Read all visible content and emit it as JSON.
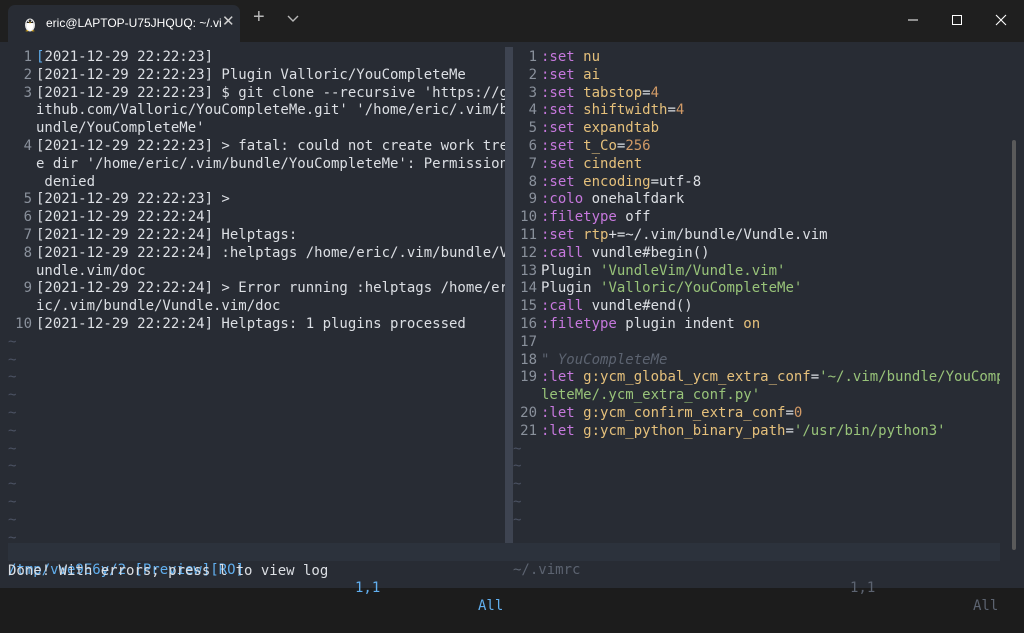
{
  "window": {
    "tab_title": "eric@LAPTOP-U75JHQUQ: ~/.vi",
    "tab_close": "✕",
    "new_tab": "+",
    "icons": {
      "tab": "linux-penguin-icon",
      "dropdown": "chevron-down-icon",
      "minimize": "minimize-icon",
      "maximize": "maximize-icon",
      "close": "close-icon"
    }
  },
  "left_pane": {
    "lines": [
      {
        "n": "1",
        "parts": [
          [
            "cursor",
            "["
          ],
          [
            "txt",
            "2021-12-29 22:22:23]"
          ]
        ]
      },
      {
        "n": "2",
        "parts": [
          [
            "txt",
            "[2021-12-29 22:22:23] Plugin Valloric/YouCompleteMe"
          ]
        ]
      },
      {
        "n": "3",
        "parts": [
          [
            "txt",
            "[2021-12-29 22:22:23] $ git clone --recursive 'https://g"
          ]
        ]
      },
      {
        "n": "",
        "parts": [
          [
            "txt",
            "ithub.com/Valloric/YouCompleteMe.git' '/home/eric/.vim/b"
          ]
        ]
      },
      {
        "n": "",
        "parts": [
          [
            "txt",
            "undle/YouCompleteMe'"
          ]
        ]
      },
      {
        "n": "4",
        "parts": [
          [
            "txt",
            "[2021-12-29 22:22:23] > fatal: could not create work tre"
          ]
        ]
      },
      {
        "n": "",
        "parts": [
          [
            "txt",
            "e dir '/home/eric/.vim/bundle/YouCompleteMe': Permission"
          ]
        ]
      },
      {
        "n": "",
        "parts": [
          [
            "txt",
            " denied"
          ]
        ]
      },
      {
        "n": "5",
        "parts": [
          [
            "txt",
            "[2021-12-29 22:22:23] >"
          ]
        ]
      },
      {
        "n": "6",
        "parts": [
          [
            "txt",
            "[2021-12-29 22:22:24]"
          ]
        ]
      },
      {
        "n": "7",
        "parts": [
          [
            "txt",
            "[2021-12-29 22:22:24] Helptags:"
          ]
        ]
      },
      {
        "n": "8",
        "parts": [
          [
            "txt",
            "[2021-12-29 22:22:24] :helptags /home/eric/.vim/bundle/V"
          ]
        ]
      },
      {
        "n": "",
        "parts": [
          [
            "txt",
            "undle.vim/doc"
          ]
        ]
      },
      {
        "n": "9",
        "parts": [
          [
            "txt",
            "[2021-12-29 22:22:24] > Error running :helptags /home/er"
          ]
        ]
      },
      {
        "n": "",
        "parts": [
          [
            "txt",
            "ic/.vim/bundle/Vundle.vim/doc"
          ]
        ]
      },
      {
        "n": "10",
        "parts": [
          [
            "txt",
            "[2021-12-29 22:22:24] Helptags: 1 plugins processed"
          ]
        ]
      }
    ],
    "tilde_count": 12,
    "tilde": "~"
  },
  "right_pane": {
    "lines": [
      {
        "n": "1",
        "parts": [
          [
            "kw",
            ":set"
          ],
          [
            "txt",
            " "
          ],
          [
            "opt",
            "nu"
          ]
        ]
      },
      {
        "n": "2",
        "parts": [
          [
            "kw",
            ":set"
          ],
          [
            "txt",
            " "
          ],
          [
            "opt",
            "ai"
          ]
        ]
      },
      {
        "n": "3",
        "parts": [
          [
            "kw",
            ":set"
          ],
          [
            "txt",
            " "
          ],
          [
            "opt",
            "tabstop"
          ],
          [
            "txt",
            "="
          ],
          [
            "num",
            "4"
          ]
        ]
      },
      {
        "n": "4",
        "parts": [
          [
            "kw",
            ":set"
          ],
          [
            "txt",
            " "
          ],
          [
            "opt",
            "shiftwidth"
          ],
          [
            "txt",
            "="
          ],
          [
            "num",
            "4"
          ]
        ]
      },
      {
        "n": "5",
        "parts": [
          [
            "kw",
            ":set"
          ],
          [
            "txt",
            " "
          ],
          [
            "opt",
            "expandtab"
          ]
        ]
      },
      {
        "n": "6",
        "parts": [
          [
            "kw",
            ":set"
          ],
          [
            "txt",
            " "
          ],
          [
            "opt",
            "t_Co"
          ],
          [
            "txt",
            "="
          ],
          [
            "num",
            "256"
          ]
        ]
      },
      {
        "n": "7",
        "parts": [
          [
            "kw",
            ":set"
          ],
          [
            "txt",
            " "
          ],
          [
            "opt",
            "cindent"
          ]
        ]
      },
      {
        "n": "8",
        "parts": [
          [
            "kw",
            ":set"
          ],
          [
            "txt",
            " "
          ],
          [
            "opt",
            "encoding"
          ],
          [
            "txt",
            "=utf-8"
          ]
        ]
      },
      {
        "n": "9",
        "parts": [
          [
            "kw",
            ":colo"
          ],
          [
            "txt",
            " onehalfdark"
          ]
        ]
      },
      {
        "n": "10",
        "parts": [
          [
            "kw",
            ":filetype"
          ],
          [
            "txt",
            " off"
          ]
        ]
      },
      {
        "n": "11",
        "parts": [
          [
            "kw",
            ":set"
          ],
          [
            "txt",
            " "
          ],
          [
            "opt",
            "rtp"
          ],
          [
            "txt",
            "+=~/.vim/bundle/Vundle.vim"
          ]
        ]
      },
      {
        "n": "12",
        "parts": [
          [
            "kw",
            ":call"
          ],
          [
            "txt",
            " vundle#begin()"
          ]
        ]
      },
      {
        "n": "13",
        "parts": [
          [
            "txt",
            "Plugin "
          ],
          [
            "str",
            "'VundleVim/Vundle.vim'"
          ]
        ]
      },
      {
        "n": "14",
        "parts": [
          [
            "txt",
            "Plugin "
          ],
          [
            "str",
            "'Valloric/YouCompleteMe'"
          ]
        ]
      },
      {
        "n": "15",
        "parts": [
          [
            "kw",
            ":call"
          ],
          [
            "txt",
            " vundle#end()"
          ]
        ]
      },
      {
        "n": "16",
        "parts": [
          [
            "kw",
            ":filetype"
          ],
          [
            "txt",
            " plugin indent "
          ],
          [
            "opt",
            "on"
          ]
        ]
      },
      {
        "n": "17",
        "parts": []
      },
      {
        "n": "18",
        "parts": [
          [
            "cmt",
            "\" YouCompleteMe"
          ]
        ]
      },
      {
        "n": "19",
        "parts": [
          [
            "kw",
            ":let"
          ],
          [
            "txt",
            " "
          ],
          [
            "opt",
            "g:ycm_global_ycm_extra_conf"
          ],
          [
            "txt",
            "="
          ],
          [
            "str",
            "'~/.vim/bundle/YouComp"
          ]
        ]
      },
      {
        "n": "",
        "parts": [
          [
            "str",
            "leteMe/.ycm_extra_conf.py'"
          ]
        ]
      },
      {
        "n": "20",
        "parts": [
          [
            "kw",
            ":let"
          ],
          [
            "txt",
            " "
          ],
          [
            "opt",
            "g:ycm_confirm_extra_conf"
          ],
          [
            "txt",
            "="
          ],
          [
            "num",
            "0"
          ]
        ]
      },
      {
        "n": "21",
        "parts": [
          [
            "kw",
            ":let"
          ],
          [
            "txt",
            " "
          ],
          [
            "opt",
            "g:ycm_python_binary_path"
          ],
          [
            "txt",
            "="
          ],
          [
            "str",
            "'/usr/bin/python3'"
          ]
        ]
      }
    ],
    "tilde_count": 5,
    "tilde": "~"
  },
  "status": {
    "left_file": "/tmp/vve9E6y/2 [Preview][RO]",
    "left_pos": "1,1",
    "left_all": "All",
    "right_file": "~/.vimrc",
    "right_pos": "1,1",
    "right_all": "All"
  },
  "cmdline": "Done! With errors; press l to view log",
  "colors": {
    "keyword": "#c678dd",
    "option": "#e5c07b",
    "string": "#98c379",
    "number": "#d19a66",
    "comment": "#5c6370",
    "background": "#282c34"
  }
}
